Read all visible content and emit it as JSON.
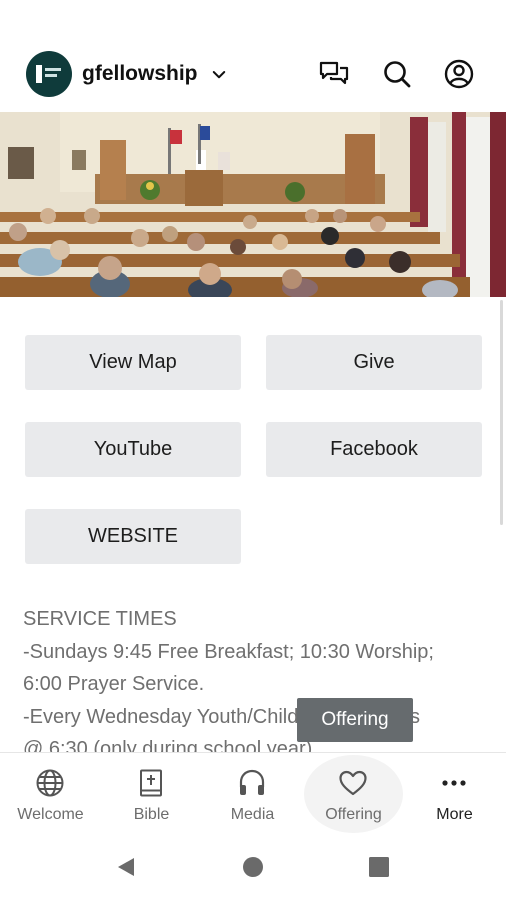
{
  "app": {
    "name": "gfellowship"
  },
  "header": {
    "icons": [
      "chat-icon",
      "search-icon",
      "account-icon"
    ]
  },
  "buttons": {
    "view_map": "View Map",
    "give": "Give",
    "youtube": "YouTube",
    "facebook": "Facebook",
    "website": "WEBSITE"
  },
  "services": {
    "heading": "SERVICE TIMES",
    "line1": "-Sundays 9:45 Free Breakfast; 10:30 Worship;",
    "line2": "6:00 Prayer Service.",
    "line3": "-Every Wednesday Youth/Children's services",
    "line4": "@ 6:30 (only during school year)"
  },
  "tooltip": {
    "text": "Offering"
  },
  "bottom_nav": {
    "items": [
      {
        "label": "Welcome",
        "icon": "globe-icon"
      },
      {
        "label": "Bible",
        "icon": "book-icon"
      },
      {
        "label": "Media",
        "icon": "headphones-icon"
      },
      {
        "label": "Offering",
        "icon": "heart-icon"
      },
      {
        "label": "More",
        "icon": "more-icon"
      }
    ]
  },
  "colors": {
    "logo_bg": "#0f3b3b",
    "button_bg": "#e9eaec",
    "tooltip_bg": "#666b6e",
    "text_gray": "#6f6f6f"
  }
}
